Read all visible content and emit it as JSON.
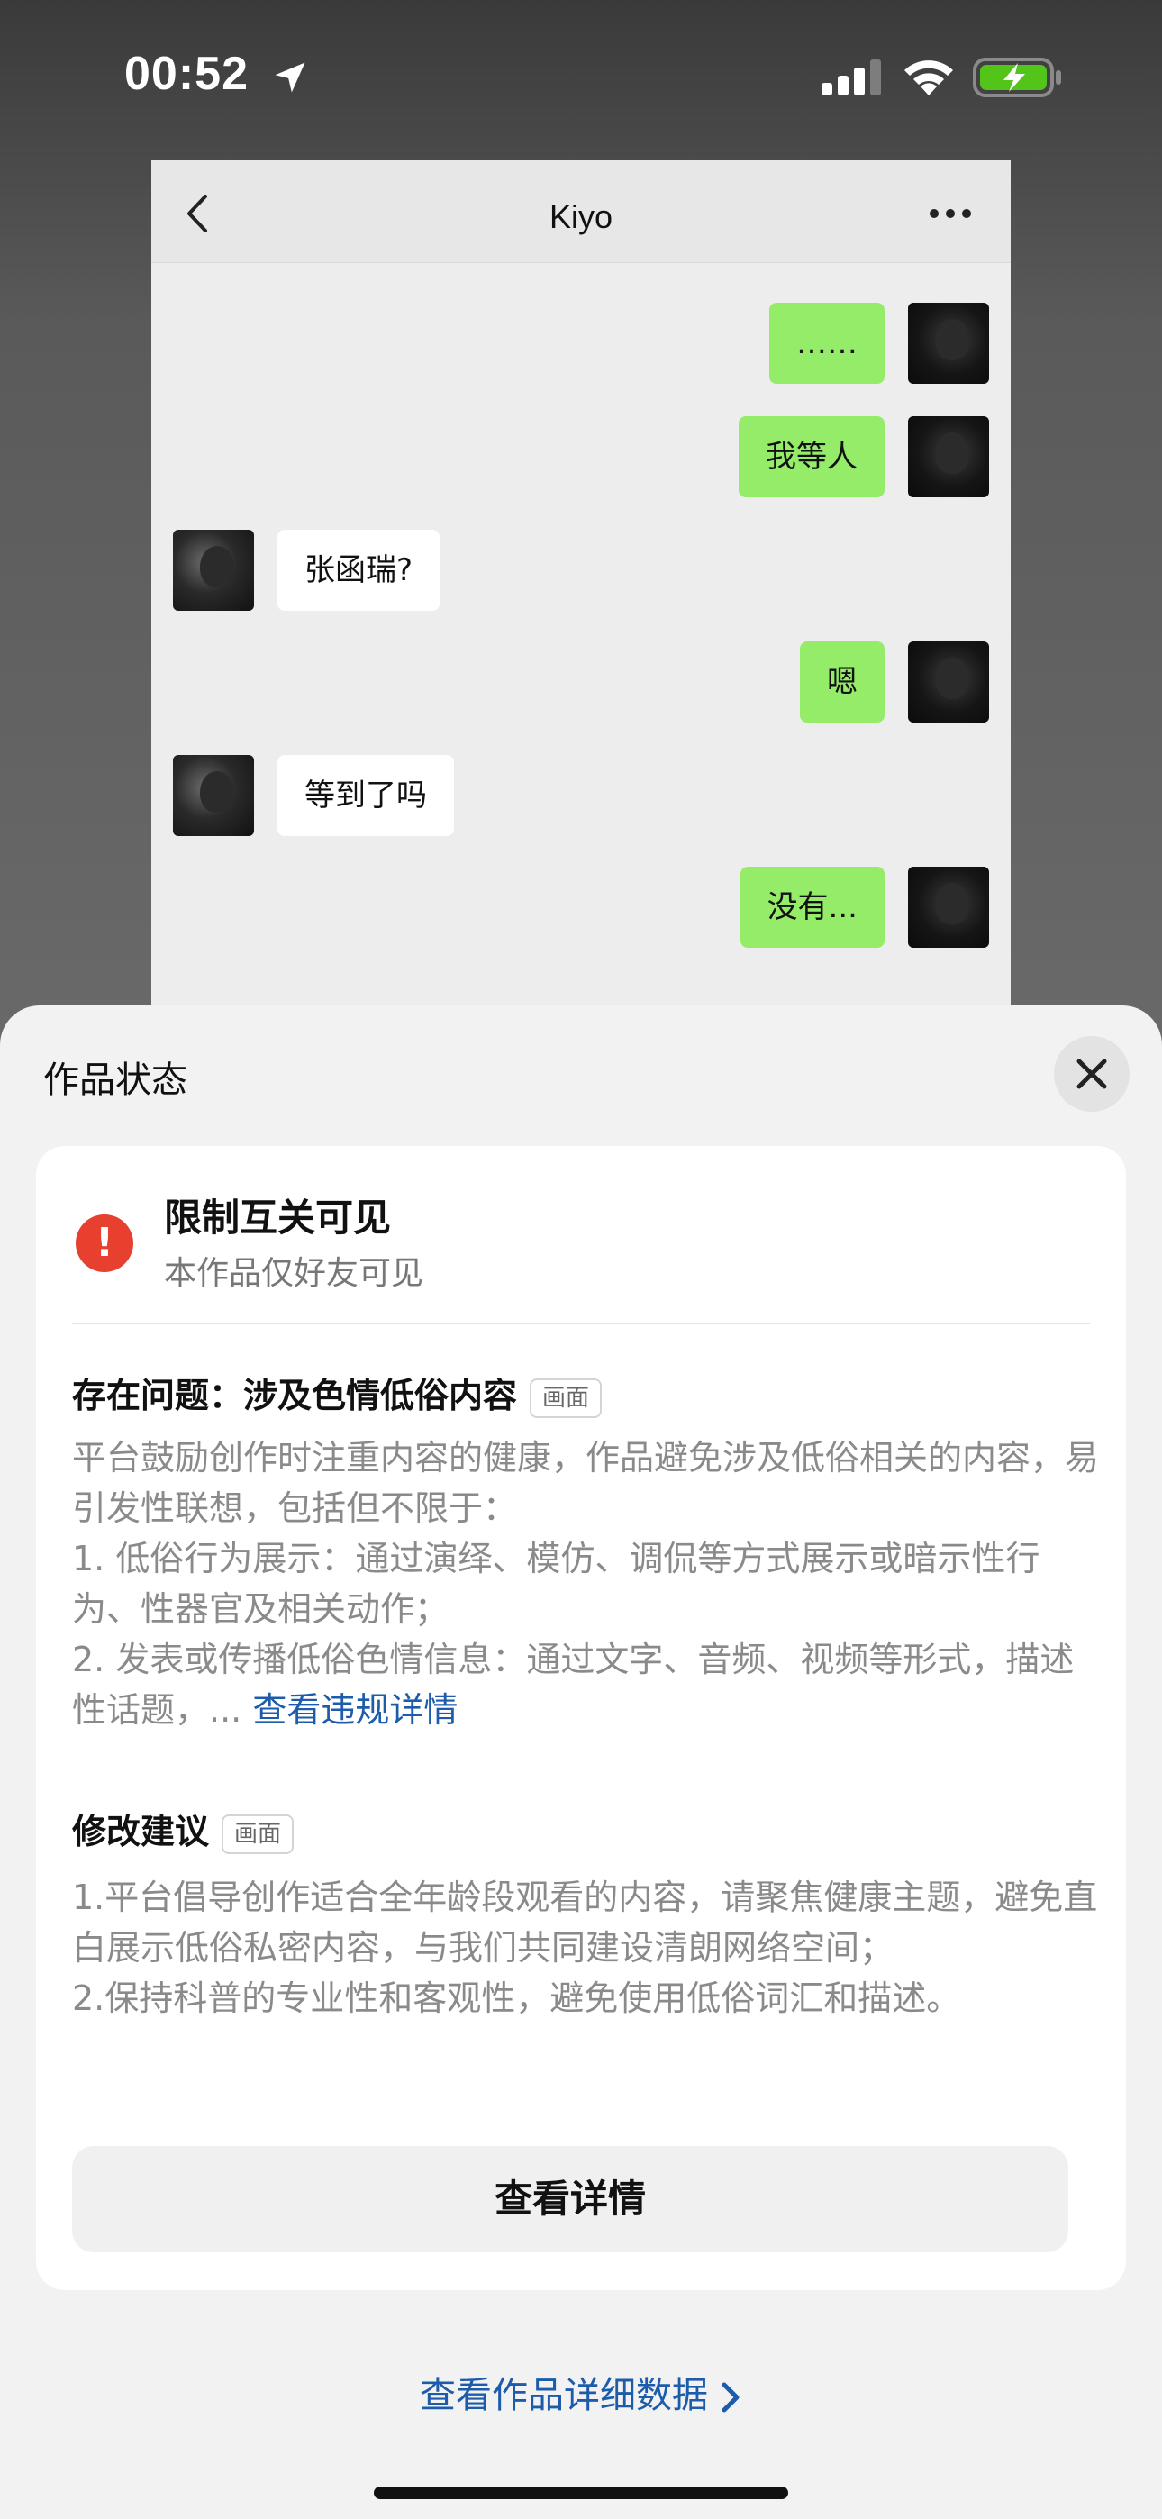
{
  "status_bar": {
    "time": "00:52",
    "icons": [
      "location-arrow-icon",
      "signal-bars-icon",
      "wifi-icon",
      "battery-charging-icon"
    ],
    "battery_color": "#52c41a"
  },
  "chat": {
    "title": "Kiyo",
    "messages": [
      {
        "side": "me",
        "text": "……"
      },
      {
        "side": "me",
        "text": "我等人"
      },
      {
        "side": "them",
        "text": "张函瑞?"
      },
      {
        "side": "me",
        "text": "嗯"
      },
      {
        "side": "them",
        "text": "等到了吗"
      },
      {
        "side": "me",
        "text": "没有..."
      }
    ]
  },
  "sheet": {
    "title": "作品状态",
    "status": {
      "title": "限制互关可见",
      "subtitle": "本作品仅好友可见",
      "icon_text": "!"
    },
    "issue": {
      "title": "存在问题：涉及色情低俗内容",
      "tag": "画面",
      "body": "平台鼓励创作时注重内容的健康，作品避免涉及低俗相关的内容，易引发性联想，包括但不限于：\n1. 低俗行为展示：通过演绎、模仿、调侃等方式展示或暗示性行为、性器官及相关动作；\n2. 发表或传播低俗色情信息：通过文字、音频、视频等形式，描述性话题，... ",
      "link": "查看违规详情"
    },
    "suggestion": {
      "title": "修改建议",
      "tag": "画面",
      "body": "1.平台倡导创作适合全年龄段观看的内容，请聚焦健康主题，避免直白展示低俗私密内容，与我们共同建设清朗网络空间；\n2.保持科普的专业性和客观性，避免使用低俗词汇和描述。"
    },
    "detail_button": "查看详情",
    "data_link": "查看作品详细数据"
  },
  "colors": {
    "accent_link": "#1d5cab",
    "warning": "#e8402f",
    "bubble_me": "#95ec69",
    "bubble_them": "#ffffff"
  }
}
